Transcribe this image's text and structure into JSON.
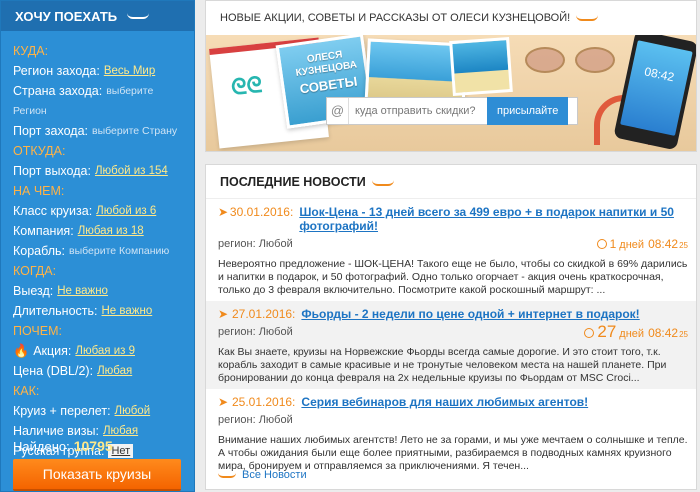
{
  "sidebar": {
    "title": "ХОЧУ ПОЕХАТЬ",
    "rows": [
      {
        "type": "section",
        "label": "КУДА:"
      },
      {
        "type": "field",
        "label": "Регион захода:",
        "value": "Весь Мир",
        "style": "link"
      },
      {
        "type": "field",
        "label": "Страна захода:",
        "value": "выберите",
        "style": "hint"
      },
      {
        "type": "hint-only",
        "value": "Регион"
      },
      {
        "type": "field",
        "label": "Порт захода:",
        "value": "выберите Страну",
        "style": "hint"
      },
      {
        "type": "section",
        "label": "ОТКУДА:"
      },
      {
        "type": "field",
        "label": "Порт выхода:",
        "value": "Любой из 154",
        "style": "link"
      },
      {
        "type": "section",
        "label": "НА ЧЕМ:"
      },
      {
        "type": "field",
        "label": "Класс круиза:",
        "value": "Любой из 6",
        "style": "link"
      },
      {
        "type": "field",
        "label": "Компания:",
        "value": "Любая из 18",
        "style": "link"
      },
      {
        "type": "field",
        "label": "Корабль:",
        "value": "выберите Компанию",
        "style": "hint"
      },
      {
        "type": "section",
        "label": "КОГДА:"
      },
      {
        "type": "field",
        "label": "Выезд:",
        "value": "Не важно",
        "style": "link"
      },
      {
        "type": "field",
        "label": "Длительность:",
        "value": "Не важно",
        "style": "link"
      },
      {
        "type": "section",
        "label": "ПОЧЕМ:"
      },
      {
        "type": "field",
        "label": "Акция:",
        "value": "Любая из 9",
        "style": "link",
        "icon": "fire-icon"
      },
      {
        "type": "field",
        "label": "Цена (DBL/2):",
        "value": "Любая",
        "style": "link"
      },
      {
        "type": "section",
        "label": "КАК:"
      },
      {
        "type": "field",
        "label": "Круиз + перелет:",
        "value": "Любой",
        "style": "link"
      },
      {
        "type": "field",
        "label": "Наличие визы:",
        "value": "Любая",
        "style": "link"
      },
      {
        "type": "field",
        "label": "Русская группа:",
        "value": "Нет",
        "style": "box"
      }
    ],
    "found_label": "Найдено:",
    "found_count": "10795",
    "button_label": "Показать круизы"
  },
  "banner": {
    "title": "НОВЫЕ АКЦИИ, СОВЕТЫ И РАССКАЗЫ ОТ ОЛЕСИ КУЗНЕЦОВОЙ!",
    "postcard_line1": "ОЛЕСЯ",
    "postcard_line2": "КУЗНЕЦОВА",
    "postcard_line3": "СОВЕТЫ",
    "phone_time": "08:42",
    "search_placeholder": "куда отправить скидки?",
    "search_button": "присылайте"
  },
  "news": {
    "title": "ПОСЛЕДНИЕ НОВОСТИ",
    "items": [
      {
        "date": "30.01.2016:",
        "title": "Шок-Цена - 13 дней всего за 499 евро + в подарок напитки и 50 фотографий!",
        "region": "регион: Любой",
        "days": "1",
        "days_label": "дней",
        "time": "08:42",
        "sec": "25",
        "body": "Невероятно предложение - ШОК-ЦЕНА! Такого еще не было, чтобы со скидкой в 69% дарились и напитки в подарок, и 50 фотографий. Одно только огорчает - акция очень краткосрочная, только до 3 февраля включительно. Посмотрите какой роскошный маршрут: ..."
      },
      {
        "date": "27.01.2016:",
        "title": "Фьорды - 2 недели по цене одной + интернет в подарок!",
        "region": "регион: Любой",
        "days": "27",
        "days_label": "дней",
        "time": "08:42",
        "sec": "25",
        "body": "Как Вы знаете, круизы на Норвежские Фьорды всегда самые дорогие. И это стоит того, т.к. корабль заходит в самые красивые и не тронутые человеком места на нашей планете. При бронировании до конца февраля на 2х недельные круизы по Фьордам от MSC Croci..."
      },
      {
        "date": "25.01.2016:",
        "title": "Серия вебинаров для наших любимых агентов!",
        "region": "регион: Любой",
        "body": "Внимание наших любимых агентств! Лето не за горами, и  мы уже мечтаем о солнышке и тепле. А чтобы ожидания были еще более приятными,  разбираемся в подводных камнях круизного мира, бронируем и отправляемся  за приключениями. Я течен..."
      }
    ],
    "all_news": "Все Новости"
  }
}
